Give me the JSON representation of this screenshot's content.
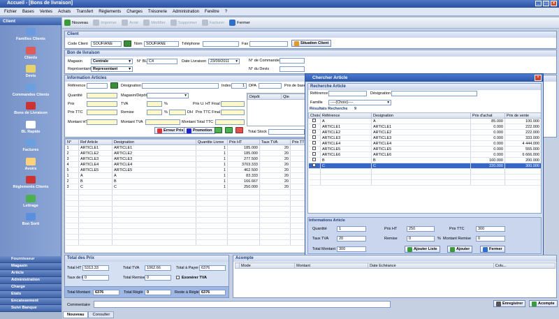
{
  "window": {
    "title": "Accueil - [Bons de livraison]"
  },
  "menu": [
    "Fichier",
    "Bases",
    "Ventes",
    "Achats",
    "Transfert",
    "Règlements",
    "Charges",
    "Trésorerie",
    "Administration",
    "Fenêtre",
    "?"
  ],
  "left": {
    "header": "Client",
    "items": [
      "Familles Clients",
      "Clients",
      "Devis",
      "Commandes Clients",
      "Bons de Livraison",
      "BL Rapide",
      "Factures",
      "Avoirs",
      "Règlements Clients",
      "Lettrage",
      "Bon Sorti"
    ],
    "bottom": [
      "Fournisseur",
      "Magasin",
      "Article",
      "Administration",
      "Charge",
      "Etats",
      "Encaissement",
      "Suivi Banque"
    ]
  },
  "toolbar": {
    "nouveau": "Nouveau",
    "imprimer": "Imprimer",
    "avoir": "Avoir",
    "modifier": "Modifier",
    "supprimer": "Supprimer",
    "facturer": "Facturer",
    "fermer": "Fermer"
  },
  "client": {
    "title": "Client",
    "code_label": "Code Client",
    "code": "SOUFIANE",
    "nom_label": "Nom",
    "nom": "SOUFIANE",
    "tel_label": "Téléphone",
    "tel": "",
    "fax_label": "Fax",
    "fax": "",
    "situation": "Situation Client"
  },
  "bl": {
    "title": "Bon de livraison",
    "magasin_label": "Magasin",
    "magasin": "Centrale",
    "nbl_label": "N° BL",
    "nbl": "C4",
    "date_label": "Date Livraison",
    "date": "23/09/2011",
    "ncmd_label": "N° de Commande",
    "ncmd": "",
    "rep_label": "Représentant",
    "rep": "Representant",
    "ndevis_label": "N° du Devis",
    "ndevis": ""
  },
  "info": {
    "title": "Information Articles",
    "ref": "Référence",
    "desig": "Désignation",
    "index_label": "Index",
    "index": "1",
    "dpa": "DPA",
    "prix_base": "Prix de base",
    "qte": "Quantité",
    "magdep": "Magasin/Dépôt",
    "prix": "Prix",
    "tva": "TVA",
    "pct": "%",
    "puht": "Prix U. HT Final",
    "pttc": "Prix TTC",
    "remise": "Remise",
    "dh": "DH",
    "pttcf": "Prix TTC Final",
    "mht": "Montant HT",
    "mtva": "Montant TVA",
    "mtttc": "Montant Total TTC",
    "erreur": "Erreur Prix",
    "promo": "Promotion",
    "depot": "Dépôt",
    "qte_col": "Qte",
    "total_stock": "Total Stock"
  },
  "lines": {
    "headers": [
      "N°",
      "Ref Article",
      "Designation",
      "Quantite Livree",
      "Prix HT",
      "Taux TVA",
      "Prix TT"
    ],
    "rows": [
      [
        "1",
        "ARTICLE1",
        "ARTICLE1",
        "1",
        "185.000",
        "20",
        ""
      ],
      [
        "2",
        "ARTICLE2",
        "ARTICLE2",
        "1",
        "185.000",
        "20",
        ""
      ],
      [
        "3",
        "ARTICLE3",
        "ARTICLE3",
        "1",
        "277.500",
        "20",
        ""
      ],
      [
        "4",
        "ARTICLE4",
        "ARTICLE4",
        "1",
        "3703.333",
        "20",
        ""
      ],
      [
        "5",
        "ARTICLE5",
        "ARTICLE5",
        "1",
        "462.500",
        "20",
        ""
      ],
      [
        "1",
        "A",
        "A",
        "1",
        "83.333",
        "20",
        ""
      ],
      [
        "2",
        "B",
        "B",
        "1",
        "166.667",
        "20",
        ""
      ],
      [
        "3",
        "C",
        "C",
        "1",
        "250.000",
        "20",
        ""
      ]
    ]
  },
  "totals": {
    "title": "Total des Prix",
    "ht_label": "Total HT",
    "ht": "5313.33",
    "tva_label": "Total TVA",
    "tva": "1062.66",
    "payer_label": "Total à Payer",
    "payer": "6376",
    "taux_label": "Taux de Remise",
    "taux": "0",
    "remise_label": "Total Remise",
    "remise": "0",
    "exo": "Exonérer TVA",
    "montant_label": "Total Montant",
    "montant": "6376",
    "regle_label": "Total Réglé",
    "regle": "0",
    "reste_label": "Reste à Régler",
    "reste": "6376"
  },
  "acompte": {
    "title": "Acompte",
    "headers": [
      "Mode",
      "Montant",
      "Date Echéance",
      "Colu..."
    ]
  },
  "comment": {
    "label": "Commentaire",
    "value": ""
  },
  "actions": {
    "enregistrer": "Enregistrer",
    "acompte": "Acompte"
  },
  "tabs": [
    "Nouveau",
    "Consulter"
  ],
  "dialog": {
    "title": "Chercher Article",
    "search_title": "Recherche Article",
    "ref_label": "Référence",
    "desig_label": "Désignation",
    "famille_label": "Famille",
    "famille": "----(Choix)----",
    "results_label": "Résultats Recherche",
    "results_count": "9",
    "headers": [
      "Choix",
      "Référence",
      "Designation",
      "Prix d'achat",
      "Prix de vente"
    ],
    "rows": [
      [
        "A",
        "A",
        "85.000",
        "100.000"
      ],
      [
        "ARTICLE1",
        "ARTICLE1",
        "0.000",
        "222.000"
      ],
      [
        "ARTICLE2",
        "ARTICLE2",
        "0.000",
        "222.000"
      ],
      [
        "ARTICLE3",
        "ARTICLE3",
        "0.000",
        "333.000"
      ],
      [
        "ARTICLE4",
        "ARTICLE4",
        "0.000",
        "4 444.000"
      ],
      [
        "ARTICLE5",
        "ARTICLE5",
        "0.000",
        "555.000"
      ],
      [
        "ARTICLE6",
        "ARTICLE6",
        "0.000",
        "6 666.000"
      ],
      [
        "B",
        "B",
        "160.000",
        "200.000"
      ],
      [
        "C",
        "C",
        "220.000",
        "300.000"
      ]
    ],
    "info_title": "Informations Article",
    "qte_label": "Quantité",
    "qte": "1",
    "pht_label": "Prix HT",
    "pht": "250",
    "pttc_label": "Prix TTC",
    "pttc": "300",
    "tva_label": "Taux TVA",
    "tva": "20",
    "remise_label": "Remise",
    "remise": "0",
    "pct": "%",
    "mremise_label": "Montant Remise",
    "mremise": "0",
    "tm_label": "Total Montant",
    "tm": "300",
    "ajouter_liste": "Ajouter Liste",
    "ajouter": "Ajouter",
    "fermer": "Fermer"
  }
}
